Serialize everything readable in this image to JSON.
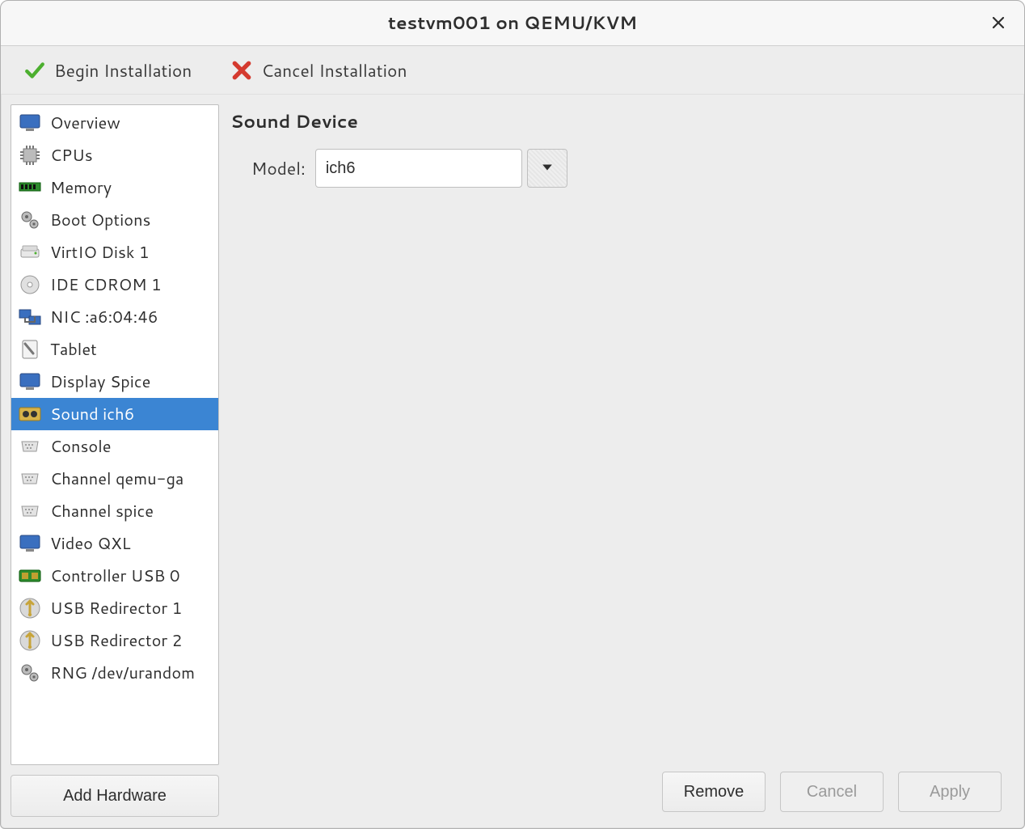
{
  "window": {
    "title": "testvm001 on QEMU/KVM"
  },
  "toolbar": {
    "begin_label": "Begin Installation",
    "cancel_label": "Cancel Installation"
  },
  "sidebar": {
    "items": [
      {
        "icon": "monitor-icon",
        "label": "Overview",
        "selected": false
      },
      {
        "icon": "cpu-icon",
        "label": "CPUs",
        "selected": false
      },
      {
        "icon": "memory-icon",
        "label": "Memory",
        "selected": false
      },
      {
        "icon": "gears-icon",
        "label": "Boot Options",
        "selected": false
      },
      {
        "icon": "disk-icon",
        "label": "VirtIO Disk 1",
        "selected": false
      },
      {
        "icon": "cdrom-icon",
        "label": "IDE CDROM 1",
        "selected": false
      },
      {
        "icon": "nic-icon",
        "label": "NIC :a6:04:46",
        "selected": false
      },
      {
        "icon": "tablet-icon",
        "label": "Tablet",
        "selected": false
      },
      {
        "icon": "monitor-icon",
        "label": "Display Spice",
        "selected": false
      },
      {
        "icon": "sound-icon",
        "label": "Sound ich6",
        "selected": true
      },
      {
        "icon": "serial-icon",
        "label": "Console",
        "selected": false
      },
      {
        "icon": "serial-icon",
        "label": "Channel qemu-ga",
        "selected": false
      },
      {
        "icon": "serial-icon",
        "label": "Channel spice",
        "selected": false
      },
      {
        "icon": "monitor-icon",
        "label": "Video QXL",
        "selected": false
      },
      {
        "icon": "usb-icon",
        "label": "Controller USB 0",
        "selected": false
      },
      {
        "icon": "usb-redir-icon",
        "label": "USB Redirector 1",
        "selected": false
      },
      {
        "icon": "usb-redir-icon",
        "label": "USB Redirector 2",
        "selected": false
      },
      {
        "icon": "gears-icon",
        "label": "RNG /dev/urandom",
        "selected": false
      }
    ]
  },
  "add_hardware_label": "Add Hardware",
  "details": {
    "heading": "Sound Device",
    "model_label": "Model:",
    "model_value": "ich6"
  },
  "footer": {
    "remove_label": "Remove",
    "cancel_label": "Cancel",
    "apply_label": "Apply",
    "cancel_enabled": false,
    "apply_enabled": false
  }
}
